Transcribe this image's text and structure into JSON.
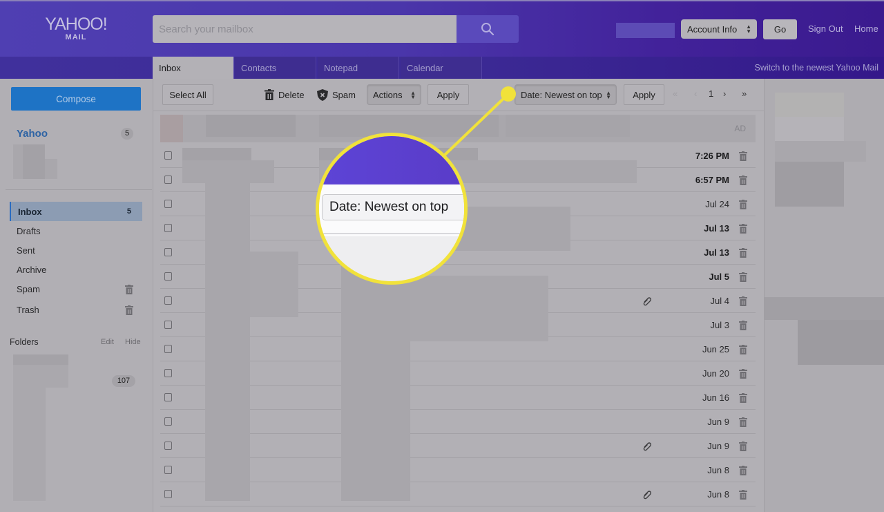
{
  "header": {
    "logo_brand": "YAHOO!",
    "logo_sub": "MAIL",
    "search_placeholder": "Search your mailbox",
    "search_icon": "search-icon",
    "account_select": "Account Info",
    "go_label": "Go",
    "sign_out": "Sign Out",
    "home": "Home"
  },
  "tabs": [
    {
      "label": "Inbox",
      "active": true
    },
    {
      "label": "Contacts",
      "active": false
    },
    {
      "label": "Notepad",
      "active": false
    },
    {
      "label": "Calendar",
      "active": false
    }
  ],
  "switch_link": "Switch to the newest Yahoo Mail",
  "sidebar": {
    "compose": "Compose",
    "account_name": "Yahoo",
    "account_count": "5",
    "nav": [
      {
        "label": "Inbox",
        "count": "5",
        "active": true
      },
      {
        "label": "Drafts"
      },
      {
        "label": "Sent"
      },
      {
        "label": "Archive"
      },
      {
        "label": "Spam",
        "icon": "trash-icon"
      },
      {
        "label": "Trash",
        "icon": "trash-icon"
      }
    ],
    "folders_label": "Folders",
    "folders_edit": "Edit",
    "folders_hide": "Hide",
    "folder_count": "107"
  },
  "toolbar": {
    "select_all": "Select All",
    "delete": "Delete",
    "spam": "Spam",
    "actions": "Actions",
    "apply1": "Apply",
    "sort": "Date: Newest on top",
    "apply2": "Apply",
    "page": "1"
  },
  "ad_label": "AD",
  "messages": [
    {
      "date": "7:26 PM",
      "unread": true,
      "attachment": false
    },
    {
      "date": "6:57 PM",
      "unread": true,
      "attachment": false
    },
    {
      "date": "Jul 24",
      "unread": false,
      "attachment": false
    },
    {
      "date": "Jul 13",
      "unread": true,
      "attachment": false
    },
    {
      "date": "Jul 13",
      "unread": true,
      "attachment": false
    },
    {
      "date": "Jul 5",
      "unread": true,
      "attachment": false
    },
    {
      "date": "Jul 4",
      "unread": false,
      "attachment": true
    },
    {
      "date": "Jul 3",
      "unread": false,
      "attachment": false
    },
    {
      "date": "Jun 25",
      "unread": false,
      "attachment": false
    },
    {
      "date": "Jun 20",
      "unread": false,
      "attachment": false
    },
    {
      "date": "Jun 16",
      "unread": false,
      "attachment": false
    },
    {
      "date": "Jun 9",
      "unread": false,
      "attachment": false
    },
    {
      "date": "Jun 9",
      "unread": false,
      "attachment": true
    },
    {
      "date": "Jun 8",
      "unread": false,
      "attachment": false
    },
    {
      "date": "Jun 8",
      "unread": false,
      "attachment": true
    }
  ],
  "callout": {
    "text": "Date: Newest on top",
    "color": "#f1e23a"
  }
}
